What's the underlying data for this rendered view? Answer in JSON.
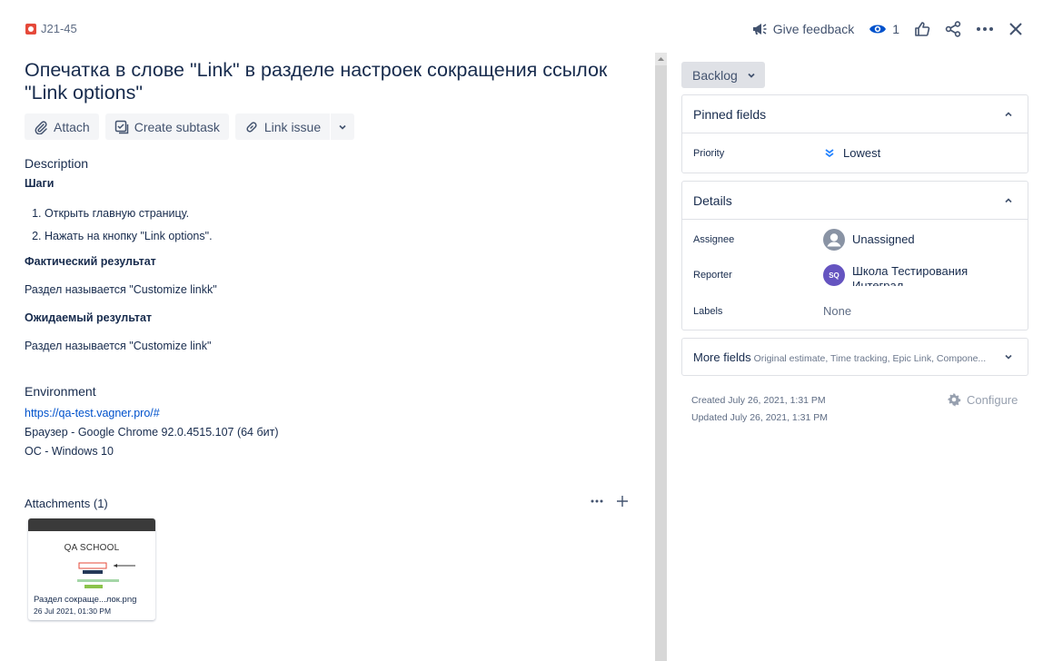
{
  "header": {
    "issue_key": "J21-45",
    "feedback_label": "Give feedback",
    "watchers_count": "1"
  },
  "issue": {
    "title": "Опечатка в слове \"Link\" в разделе настроек сокращения ссылок \"Link options\""
  },
  "actions": {
    "attach": "Attach",
    "create_subtask": "Create subtask",
    "link_issue": "Link issue"
  },
  "description": {
    "label": "Description",
    "steps_heading": "Шаги",
    "steps": [
      "Открыть главную страницу.",
      "Нажать на кнопку \"Link options\"."
    ],
    "actual_heading": "Фактический результат",
    "actual_text": "Раздел называется \"Customize linkk\"",
    "expected_heading": "Ожидаемый результат",
    "expected_text": "Раздел называется \"Customize link\""
  },
  "environment": {
    "label": "Environment",
    "url": "https://qa-test.vagner.pro/#",
    "browser": "Браузер - Google Chrome 92.0.4515.107 (64 бит)",
    "os": "ОС - Windows 10"
  },
  "attachments": {
    "label": "Attachments (1)",
    "items": [
      {
        "thumb_text": "QA SCHOOL",
        "name": "Раздел сокраще...лок.png",
        "date": "26 Jul 2021, 01:30 PM"
      }
    ]
  },
  "sidebar": {
    "status": "Backlog",
    "pinned": {
      "title": "Pinned fields",
      "priority_label": "Priority",
      "priority_value": "Lowest"
    },
    "details": {
      "title": "Details",
      "assignee_label": "Assignee",
      "assignee_value": "Unassigned",
      "reporter_label": "Reporter",
      "reporter_initials": "SQ",
      "reporter_value": "Школа Тестирования Интеграл",
      "labels_label": "Labels",
      "labels_value": "None"
    },
    "more_fields": {
      "title": "More fields",
      "hint": "Original estimate, Time tracking, Epic Link, Compone..."
    },
    "created": "Created July 26, 2021, 1:31 PM",
    "updated": "Updated July 26, 2021, 1:31 PM",
    "configure": "Configure"
  },
  "colors": {
    "link": "#0052cc",
    "bug": "#e5493a",
    "priority_lowest": "#2684ff",
    "avatar_sq": "#6554c0"
  }
}
